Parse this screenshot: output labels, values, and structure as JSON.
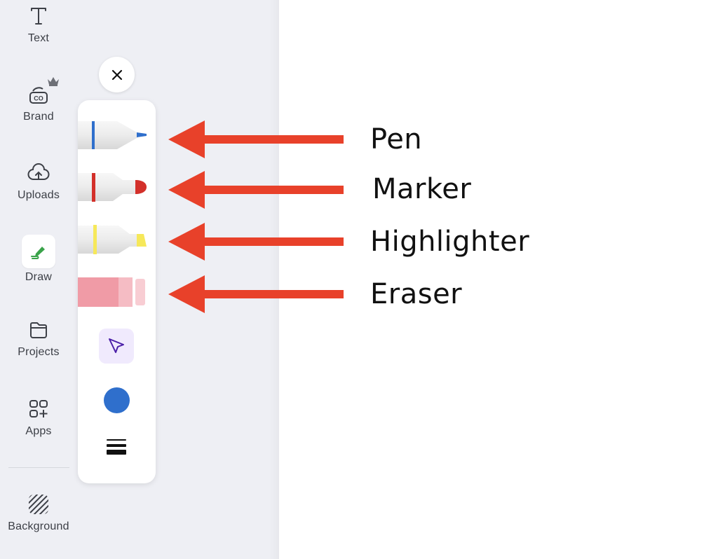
{
  "sidebar": {
    "items": [
      {
        "label": "Text",
        "icon": "text-icon"
      },
      {
        "label": "Brand",
        "icon": "brand-kit-icon",
        "badge": "crown-icon"
      },
      {
        "label": "Uploads",
        "icon": "cloud-upload-icon"
      },
      {
        "label": "Draw",
        "icon": "draw-icon",
        "active": true
      },
      {
        "label": "Projects",
        "icon": "folder-icon"
      },
      {
        "label": "Apps",
        "icon": "apps-icon"
      },
      {
        "label": "Background",
        "icon": "background-pattern-icon"
      }
    ]
  },
  "draw_toolbar": {
    "close_icon": "close-icon",
    "tools": [
      {
        "name": "pen",
        "accent": "#2f6fcc"
      },
      {
        "name": "marker",
        "accent": "#d3302a"
      },
      {
        "name": "highlighter",
        "accent": "#f6e85a"
      },
      {
        "name": "eraser",
        "accent": "#f09ba6"
      }
    ],
    "select_tool_icon": "cursor-arrow-icon",
    "selected_color": "#2f6fcc",
    "stroke_weight_icon": "stroke-weight-icon"
  },
  "annotations": {
    "arrow_color": "#e8412a",
    "labels": [
      "Pen",
      "Marker",
      "Highlighter",
      "Eraser"
    ]
  }
}
